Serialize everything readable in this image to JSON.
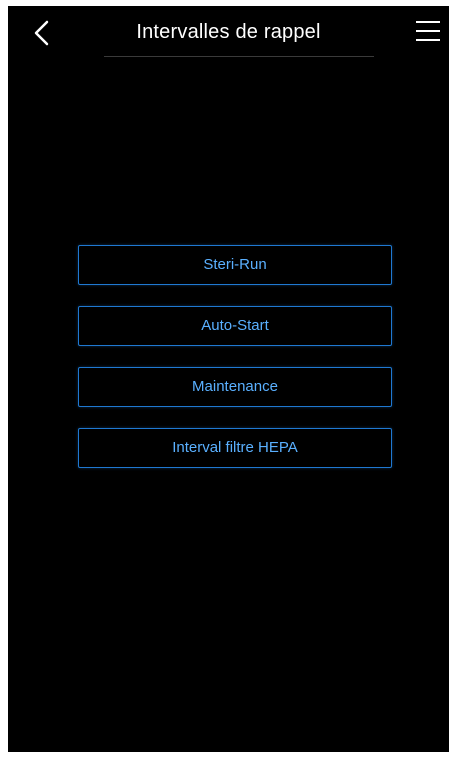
{
  "header": {
    "title": "Intervalles de rappel",
    "back_icon": "chevron-left-icon",
    "menu_icon": "hamburger-menu-icon"
  },
  "menu": {
    "items": [
      {
        "label": "Steri-Run"
      },
      {
        "label": "Auto-Start"
      },
      {
        "label": "Maintenance"
      },
      {
        "label": "Interval filtre HEPA"
      }
    ]
  },
  "colors": {
    "background": "#000000",
    "accent_border": "#1f78d1",
    "accent_text": "#5ab0ff",
    "title_text": "#ffffff"
  }
}
